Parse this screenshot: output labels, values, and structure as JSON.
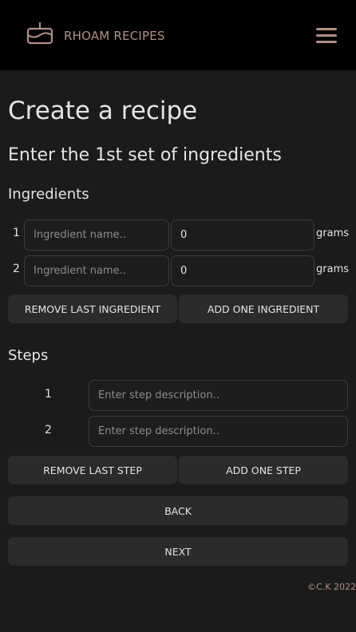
{
  "header": {
    "brand": "RHOAM RECIPES",
    "logo_icon": "cake-icon",
    "menu_icon": "hamburger-menu-icon"
  },
  "page": {
    "title": "Create a recipe",
    "subtitle": "Enter the 1st set of ingredients"
  },
  "ingredients": {
    "heading": "Ingredients",
    "rows": [
      {
        "number": "1",
        "name_placeholder": "Ingredient name..",
        "amount": "0",
        "unit": "grams"
      },
      {
        "number": "2",
        "name_placeholder": "Ingredient name..",
        "amount": "0",
        "unit": "grams"
      }
    ],
    "remove_label": "REMOVE LAST INGREDIENT",
    "add_label": "ADD ONE INGREDIENT"
  },
  "steps": {
    "heading": "Steps",
    "rows": [
      {
        "number": "1",
        "placeholder": "Enter step description.."
      },
      {
        "number": "2",
        "placeholder": "Enter step description.."
      }
    ],
    "remove_label": "REMOVE LAST STEP",
    "add_label": "ADD ONE STEP"
  },
  "nav": {
    "back_label": "BACK",
    "next_label": "NEXT"
  },
  "footer": {
    "copyright": "©C.K 2022"
  },
  "colors": {
    "background": "#1b1b1b",
    "header": "#000000",
    "accent": "#b28f86",
    "button": "#2b2b2b"
  }
}
